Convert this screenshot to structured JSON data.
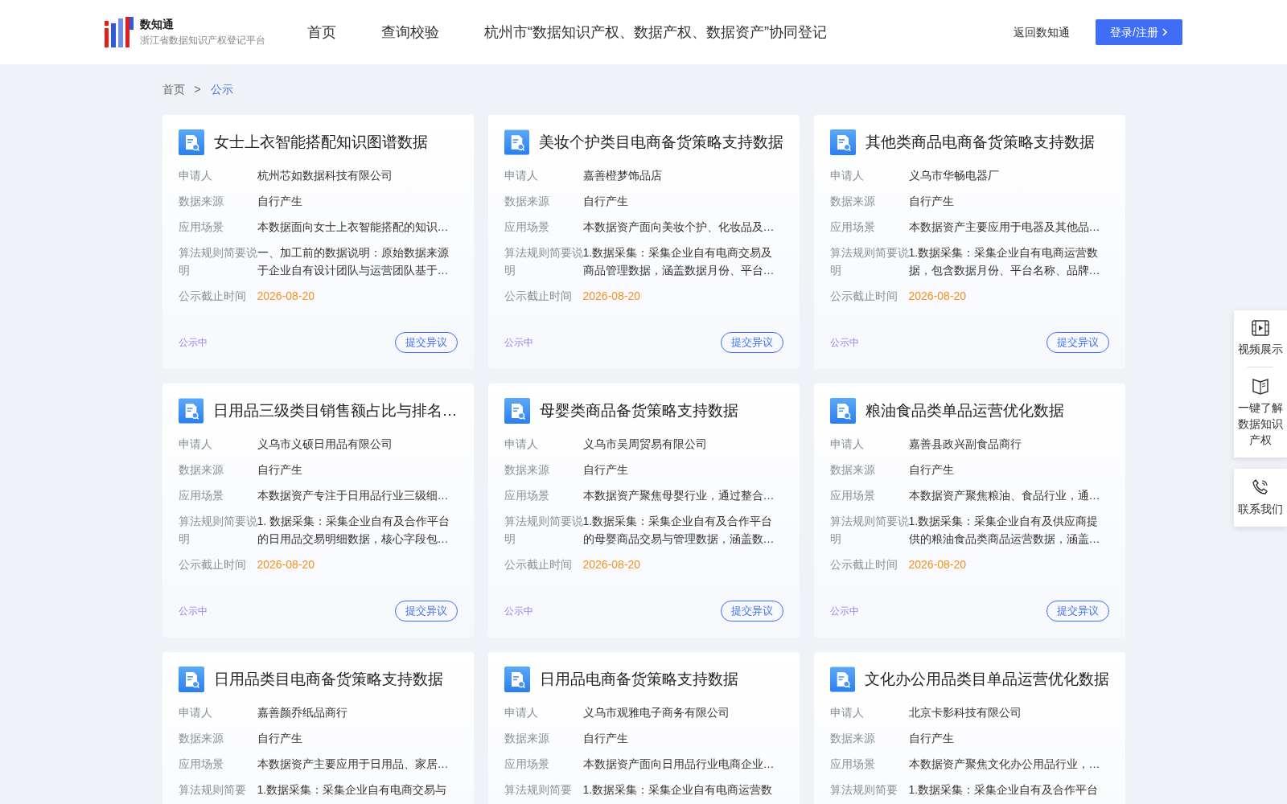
{
  "header": {
    "brand": "数知通",
    "subtitle": "浙江省数据知识产权登记平台",
    "nav": [
      "首页",
      "查询校验",
      "杭州市“数据知识产权、数据产权、数据资产”协同登记"
    ],
    "back_link": "返回数知通",
    "login_button": "登录/注册"
  },
  "breadcrumb": [
    {
      "label": "首页",
      "current": false
    },
    {
      "label": "公示",
      "current": true
    }
  ],
  "breadcrumb_separator": ">",
  "cards": [
    {
      "title": "女士上衣智能搭配知识图谱数据",
      "fields": [
        {
          "kind": "text",
          "label": "申请人",
          "lines": [
            "杭州芯如数据科技有限公司"
          ]
        },
        {
          "kind": "text",
          "label": "数据来源",
          "lines": [
            "自行产生"
          ]
        },
        {
          "kind": "text",
          "label": "应用场景",
          "lines": [
            "本数据面向女士上衣智能搭配的知识…"
          ]
        },
        {
          "kind": "text",
          "label": "算法规则简要说明",
          "lines": [
            "一、加工前的数据说明：原始数据来源",
            "于企业自有设计团队与运营团队基于…"
          ]
        },
        {
          "kind": "date",
          "label": "公示截止时间",
          "lines": [
            "2026-08-20"
          ]
        }
      ],
      "status": "公示中",
      "action": "提交异议"
    },
    {
      "title": "美妆个护类目电商备货策略支持数据",
      "fields": [
        {
          "kind": "text",
          "label": "申请人",
          "lines": [
            "嘉善橙梦饰品店"
          ]
        },
        {
          "kind": "text",
          "label": "数据来源",
          "lines": [
            "自行产生"
          ]
        },
        {
          "kind": "text",
          "label": "应用场景",
          "lines": [
            "本数据资产面向美妆个护、化妆品及…"
          ]
        },
        {
          "kind": "text",
          "label": "算法规则简要说明",
          "lines": [
            "1.数据采集：采集企业自有电商交易及",
            "商品管理数据，涵盖数据月份、平台…"
          ]
        },
        {
          "kind": "date",
          "label": "公示截止时间",
          "lines": [
            "2026-08-20"
          ]
        }
      ],
      "status": "公示中",
      "action": "提交异议"
    },
    {
      "title": "其他类商品电商备货策略支持数据",
      "fields": [
        {
          "kind": "text",
          "label": "申请人",
          "lines": [
            "义乌市华畅电器厂"
          ]
        },
        {
          "kind": "text",
          "label": "数据来源",
          "lines": [
            "自行产生"
          ]
        },
        {
          "kind": "text",
          "label": "应用场景",
          "lines": [
            "本数据资产主要应用于电器及其他品…"
          ]
        },
        {
          "kind": "text",
          "label": "算法规则简要说明",
          "lines": [
            "1.数据采集：采集企业自有电商运营数",
            "据，包含数据月份、平台名称、品牌…"
          ]
        },
        {
          "kind": "date",
          "label": "公示截止时间",
          "lines": [
            "2026-08-20"
          ]
        }
      ],
      "status": "公示中",
      "action": "提交异议"
    },
    {
      "title": "日用品三级类目销售额占比与排名…",
      "fields": [
        {
          "kind": "text",
          "label": "申请人",
          "lines": [
            "义乌市义硕日用品有限公司"
          ]
        },
        {
          "kind": "text",
          "label": "数据来源",
          "lines": [
            "自行产生"
          ]
        },
        {
          "kind": "text",
          "label": "应用场景",
          "lines": [
            "本数据资产专注于日用品行业三级细…"
          ]
        },
        {
          "kind": "text",
          "label": "算法规则简要说明",
          "lines": [
            "1. 数据采集：采集企业自有及合作平台",
            "的日用品交易明细数据，核心字段包…"
          ]
        },
        {
          "kind": "date",
          "label": "公示截止时间",
          "lines": [
            "2026-08-20"
          ]
        }
      ],
      "status": "公示中",
      "action": "提交异议"
    },
    {
      "title": "母婴类商品备货策略支持数据",
      "fields": [
        {
          "kind": "text",
          "label": "申请人",
          "lines": [
            "义乌市吴周贸易有限公司"
          ]
        },
        {
          "kind": "text",
          "label": "数据来源",
          "lines": [
            "自行产生"
          ]
        },
        {
          "kind": "text",
          "label": "应用场景",
          "lines": [
            "本数据资产聚焦母婴行业，通过整合…"
          ]
        },
        {
          "kind": "text",
          "label": "算法规则简要说明",
          "lines": [
            "1.数据采集：采集企业自有及合作平台",
            "的母婴商品交易与管理数据，涵盖数…"
          ]
        },
        {
          "kind": "date",
          "label": "公示截止时间",
          "lines": [
            "2026-08-20"
          ]
        }
      ],
      "status": "公示中",
      "action": "提交异议"
    },
    {
      "title": "粮油食品类单品运营优化数据",
      "fields": [
        {
          "kind": "text",
          "label": "申请人",
          "lines": [
            "嘉善县政兴副食品商行"
          ]
        },
        {
          "kind": "text",
          "label": "数据来源",
          "lines": [
            "自行产生"
          ]
        },
        {
          "kind": "text",
          "label": "应用场景",
          "lines": [
            "本数据资产聚焦粮油、食品行业，通…"
          ]
        },
        {
          "kind": "text",
          "label": "算法规则简要说明",
          "lines": [
            "1.数据采集：采集企业自有及供应商提",
            "供的粮油食品类商品运营数据，涵盖…"
          ]
        },
        {
          "kind": "date",
          "label": "公示截止时间",
          "lines": [
            "2026-08-20"
          ]
        }
      ],
      "status": "公示中",
      "action": "提交异议"
    },
    {
      "title": "日用品类目电商备货策略支持数据",
      "fields": [
        {
          "kind": "text",
          "label": "申请人",
          "lines": [
            "嘉善颜乔纸品商行"
          ]
        },
        {
          "kind": "text",
          "label": "数据来源",
          "lines": [
            "自行产生"
          ]
        },
        {
          "kind": "text",
          "label": "应用场景",
          "lines": [
            "本数据资产主要应用于日用品、家居…"
          ]
        },
        {
          "kind": "text",
          "label": "算法规则简要",
          "lines": [
            "1.数据采集：采集企业自有电商交易与"
          ]
        }
      ]
    },
    {
      "title": "日用品电商备货策略支持数据",
      "fields": [
        {
          "kind": "text",
          "label": "申请人",
          "lines": [
            "义乌市观雅电子商务有限公司"
          ]
        },
        {
          "kind": "text",
          "label": "数据来源",
          "lines": [
            "自行产生"
          ]
        },
        {
          "kind": "text",
          "label": "应用场景",
          "lines": [
            "本数据资产面向日用品行业电商企业…"
          ]
        },
        {
          "kind": "text",
          "label": "算法规则简要",
          "lines": [
            "1.数据采集：采集企业自有电商运营数"
          ]
        }
      ]
    },
    {
      "title": "文化办公用品类目单品运营优化数据",
      "fields": [
        {
          "kind": "text",
          "label": "申请人",
          "lines": [
            "北京卡影科技有限公司"
          ]
        },
        {
          "kind": "text",
          "label": "数据来源",
          "lines": [
            "自行产生"
          ]
        },
        {
          "kind": "text",
          "label": "应用场景",
          "lines": [
            "本数据资产聚焦文化办公用品行业，…"
          ]
        },
        {
          "kind": "text",
          "label": "算法规则简要",
          "lines": [
            "1.数据采集：采集企业自有及合作平台"
          ]
        }
      ]
    }
  ],
  "float_panels": [
    [
      {
        "kind": "video",
        "label": "视频展示"
      },
      {
        "kind": "book",
        "label": "一键了解数据知识产权"
      }
    ],
    [
      {
        "kind": "phone",
        "label": "联系我们"
      }
    ]
  ]
}
